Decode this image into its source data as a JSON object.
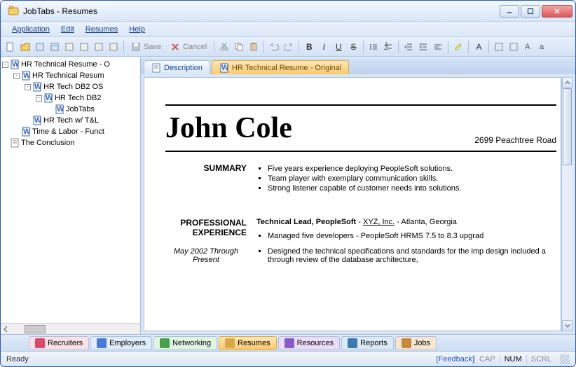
{
  "window": {
    "title": "JobTabs - Resumes"
  },
  "menu": [
    "Application",
    "Edit",
    "Resumes",
    "Help"
  ],
  "toolbar": {
    "save": "Save",
    "cancel": "Cancel"
  },
  "tree": [
    {
      "depth": 0,
      "exp": "-",
      "icon": "word",
      "label": "HR Technical Resume - O"
    },
    {
      "depth": 1,
      "exp": "-",
      "icon": "word",
      "label": "HR Technical Resum"
    },
    {
      "depth": 2,
      "exp": "-",
      "icon": "word",
      "label": "HR Tech DB2 OS"
    },
    {
      "depth": 3,
      "exp": "-",
      "icon": "word",
      "label": "HR Tech DB2"
    },
    {
      "depth": 4,
      "exp": "",
      "icon": "word",
      "label": "JobTabs"
    },
    {
      "depth": 2,
      "exp": "",
      "icon": "word",
      "label": "HR Tech w/ T&L"
    },
    {
      "depth": 1,
      "exp": "",
      "icon": "word",
      "label": "Time & Labor - Funct"
    },
    {
      "depth": 0,
      "exp": "",
      "icon": "doc",
      "label": "The Conclusion"
    }
  ],
  "doc_tabs": [
    {
      "label": "Description",
      "active": false
    },
    {
      "label": "HR Technical Resume - Original",
      "active": true
    }
  ],
  "resume": {
    "name": "John Cole",
    "address": "2699 Peachtree Road",
    "summary_label": "SUMMARY",
    "summary": [
      "Five years experience deploying PeopleSoft solutions.",
      "Team player with exemplary communication skills.",
      "Strong listener capable of customer needs into solutions."
    ],
    "experience_label": "PROFESSIONAL EXPERIENCE",
    "date_range": "May 2002 Through Present",
    "job_title_bold": "Technical Lead, PeopleSoft",
    "job_sep": " - ",
    "company": "XYZ, Inc.",
    "location": " - Atlanta, Georgia",
    "exp_bullets": [
      "Managed five developers - PeopleSoft HRMS 7.5 to 8.3 upgrad",
      "Designed the technical specifications and standards for the imp    design included a through review of the database architecture,"
    ]
  },
  "bottom_tabs": [
    {
      "label": "Recruiters",
      "bg": "#fbe0e6",
      "icon": "#d94a6a"
    },
    {
      "label": "Employers",
      "bg": "#e0ecfb",
      "icon": "#4a7ad9"
    },
    {
      "label": "Networking",
      "bg": "#e2f5e2",
      "icon": "#4aa04a"
    },
    {
      "label": "Resumes",
      "bg": "#fff1c8",
      "icon": "#d9a84a",
      "active": true
    },
    {
      "label": "Resources",
      "bg": "#ecdcf7",
      "icon": "#8a5acb"
    },
    {
      "label": "Reports",
      "bg": "#dceaf6",
      "icon": "#3a7ab0"
    },
    {
      "label": "Jobs",
      "bg": "#f6e6d2",
      "icon": "#c88a3a"
    }
  ],
  "status": {
    "ready": "Ready",
    "feedback": "[Feedback]",
    "cap": "CAP",
    "num": "NUM",
    "scrl": "SCRL"
  }
}
